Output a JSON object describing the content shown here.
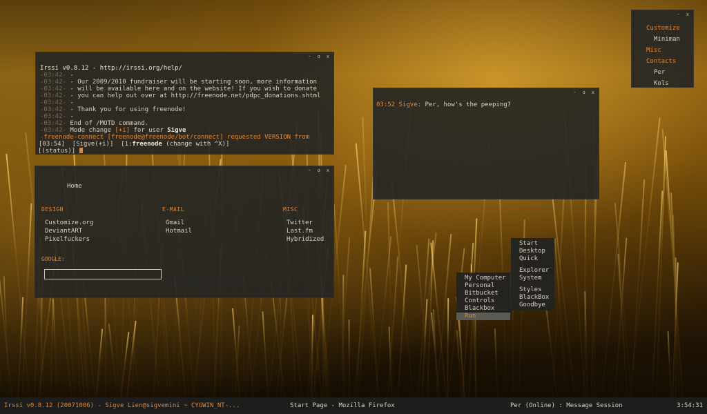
{
  "irssi": {
    "header": "Irssi v0.8.12 - http://irssi.org/help/",
    "lines": [
      {
        "time": "03:42",
        "text": "-"
      },
      {
        "time": "03:42",
        "text": "- Our 2009/2010 fundraiser will be starting soon, more information"
      },
      {
        "time": "03:42",
        "text": "- will be available here and on the website! If you wish to donate"
      },
      {
        "time": "03:42",
        "text": "- you can help out over at http://freenode.net/pdpc_donations.shtml"
      },
      {
        "time": "03:42",
        "text": "-"
      },
      {
        "time": "03:42",
        "text": "- Thank you for using freenode!"
      },
      {
        "time": "03:42",
        "text": "-"
      },
      {
        "time": "03:42",
        "text": "End of /MOTD command."
      }
    ],
    "mode_time": "03:42",
    "mode_prefix": "Mode change ",
    "mode_flag": "[+i]",
    "mode_mid": " for user ",
    "mode_user": "Sigve",
    "connect_text": "freenode-connect [freenode@freenode/bot/connect] requested VERSION from",
    "status_time": "[03:54]",
    "status_nick": "[Sigve(+i)]",
    "status_win_pre": "[1:",
    "status_win_name": "freenode",
    "status_win_post": " (change with ^X)]",
    "prompt": "[(status)] "
  },
  "startpage": {
    "home": "Home",
    "columns": [
      {
        "heading": "DESIGN",
        "links": [
          "Customize.org",
          "DeviantART",
          "Pixelfuckers"
        ]
      },
      {
        "heading": "E-MAIL",
        "links": [
          "Gmail",
          "Hotmail"
        ]
      },
      {
        "heading": "MISC",
        "links": [
          "Twitter",
          "Last.fm",
          "Hybridized"
        ]
      }
    ],
    "google_label": "GOOGLE:",
    "google_value": ""
  },
  "chat": {
    "time": "03:52",
    "nick": "Sigve:",
    "text": "Per, how's the peeping?"
  },
  "menu": {
    "items": [
      {
        "label": "Customize",
        "type": "hdr"
      },
      {
        "label": "Miniman",
        "type": "sub"
      },
      {
        "label": "Misc",
        "type": "hdr"
      },
      {
        "label": "Contacts",
        "type": "hdr"
      },
      {
        "label": "Per",
        "type": "sub"
      },
      {
        "label": "Kols",
        "type": "sub"
      }
    ]
  },
  "rootmenu": {
    "groups": [
      [
        "Start",
        "Desktop",
        "Quick"
      ],
      [
        "Explorer",
        "System"
      ],
      [
        "Styles",
        "BlackBox",
        "Goodbye"
      ]
    ]
  },
  "submenu": {
    "items": [
      "My Computer",
      "Personal",
      "Bitbucket",
      "Controls",
      "Blackbox",
      "Run"
    ],
    "active": "Run"
  },
  "window_controls": [
    "-",
    "o",
    "x"
  ],
  "taskbar": {
    "irssi_task": "Irssi v0.8.12 (20071006) - Sigve Lien@sigvemini ~ CYGWIN_NT-...",
    "firefox_task": "Start Page - Mozilla Firefox",
    "im_task": "Per (Online) : Message Session",
    "clock": "3:54:31"
  },
  "colors": {
    "accent": "#e0893a",
    "window_bg": "#262624",
    "text": "#d8d2c4"
  }
}
